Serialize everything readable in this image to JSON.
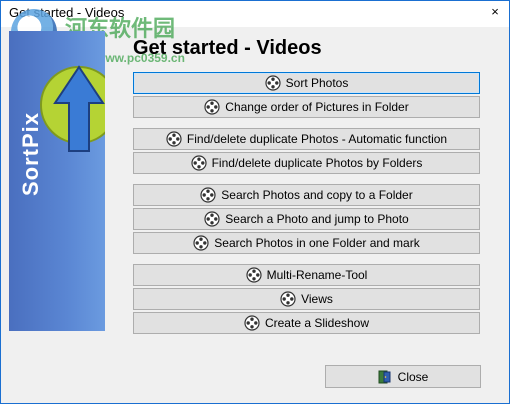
{
  "window": {
    "title": "Get started - Videos",
    "close_glyph": "×"
  },
  "watermark": {
    "text": "河东软件园",
    "url": "www.pc0359.cn"
  },
  "sidebar": {
    "brand": "SortPix",
    "accent_color": "#5a86d3",
    "arrow_color": "#3a7bd5",
    "circle_color": "#b5d334"
  },
  "main": {
    "heading": "Get started - Videos",
    "buttons": [
      {
        "label": "Sort Photos",
        "icon": "film-reel-icon",
        "focused": true
      },
      {
        "label": "Change order of Pictures in Folder",
        "icon": "film-reel-icon"
      },
      {
        "label": "Find/delete duplicate Photos - Automatic function",
        "icon": "film-reel-icon"
      },
      {
        "label": "Find/delete duplicate Photos by Folders",
        "icon": "film-reel-icon"
      },
      {
        "label": "Search Photos and copy to a Folder",
        "icon": "film-reel-icon"
      },
      {
        "label": "Search a Photo and jump to Photo",
        "icon": "film-reel-icon"
      },
      {
        "label": "Search Photos in one Folder and mark",
        "icon": "film-reel-icon"
      },
      {
        "label": "Multi-Rename-Tool",
        "icon": "film-reel-icon"
      },
      {
        "label": "Views",
        "icon": "film-reel-icon"
      },
      {
        "label": "Create a Slideshow",
        "icon": "film-reel-icon"
      }
    ]
  },
  "footer": {
    "close_label": "Close",
    "close_icon": "exit-door-icon"
  }
}
